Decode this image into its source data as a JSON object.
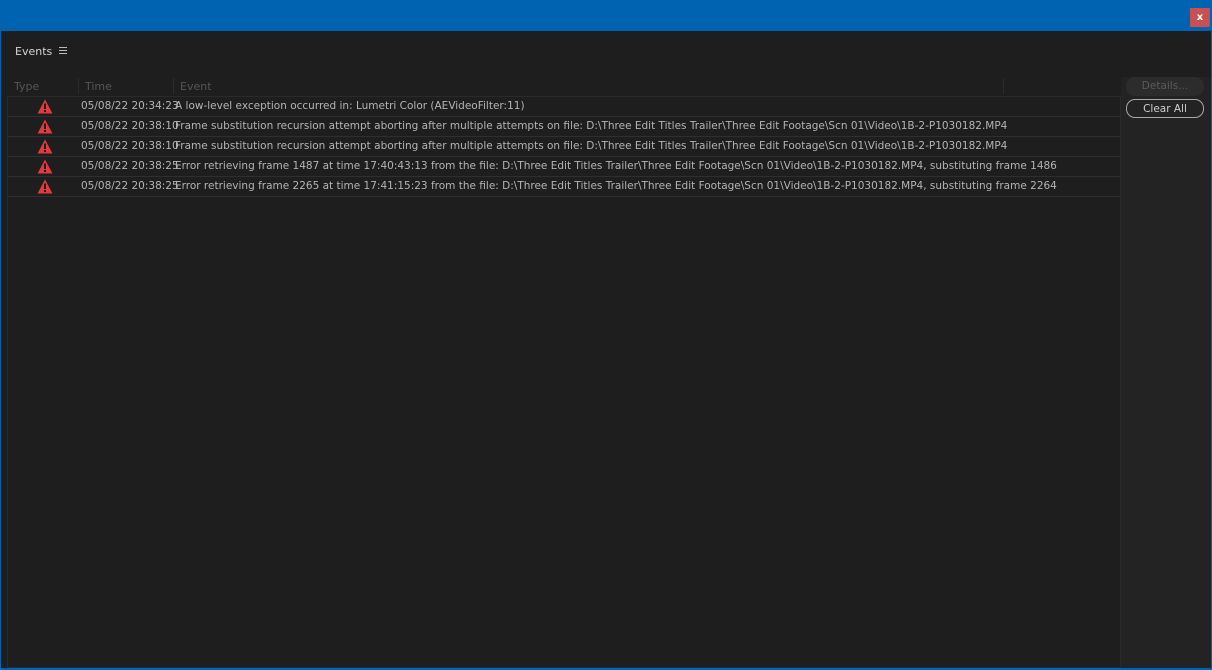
{
  "window": {
    "close_label": "x"
  },
  "panel": {
    "title": "Events",
    "menu_icon": "hamburger-menu-icon"
  },
  "table": {
    "columns": {
      "type": "Type",
      "time": "Time",
      "event": "Event"
    },
    "rows": [
      {
        "icon": "warning-icon",
        "time": "05/08/22 20:34:23",
        "event": "A low-level exception occurred in: Lumetri Color (AEVideoFilter:11)"
      },
      {
        "icon": "warning-icon",
        "time": "05/08/22 20:38:10",
        "event": "Frame substitution recursion attempt aborting after multiple attempts on file: D:\\Three Edit Titles Trailer\\Three Edit Footage\\Scn 01\\Video\\1B-2-P1030182.MP4"
      },
      {
        "icon": "warning-icon",
        "time": "05/08/22 20:38:10",
        "event": "Frame substitution recursion attempt aborting after multiple attempts on file: D:\\Three Edit Titles Trailer\\Three Edit Footage\\Scn 01\\Video\\1B-2-P1030182.MP4"
      },
      {
        "icon": "warning-icon",
        "time": "05/08/22 20:38:25",
        "event": "Error retrieving frame 1487 at time 17:40:43:13 from the file: D:\\Three Edit Titles Trailer\\Three Edit Footage\\Scn 01\\Video\\1B-2-P1030182.MP4, substituting frame 1486"
      },
      {
        "icon": "warning-icon",
        "time": "05/08/22 20:38:25",
        "event": "Error retrieving frame 2265 at time 17:41:15:23 from the file: D:\\Three Edit Titles Trailer\\Three Edit Footage\\Scn 01\\Video\\1B-2-P1030182.MP4, substituting frame 2264"
      }
    ]
  },
  "buttons": {
    "details": "Details...",
    "clear_all": "Clear All"
  },
  "colors": {
    "titlebar": "#0063b1",
    "close": "#c75050",
    "warning": "#e0393e",
    "panel_bg": "#1e1e1e"
  }
}
